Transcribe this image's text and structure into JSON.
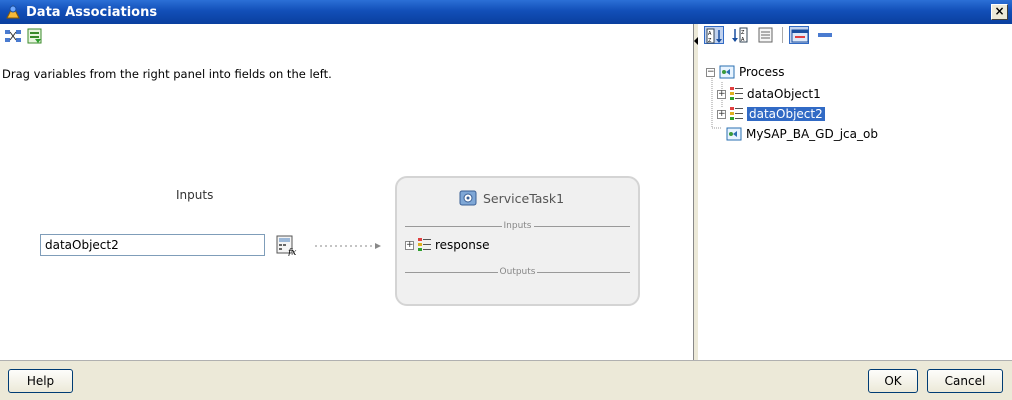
{
  "window": {
    "title": "Data Associations",
    "close_label": "×"
  },
  "left_panel": {
    "hint": "Drag variables from the right panel into fields on the left.",
    "inputs_label": "Inputs",
    "input_value": "dataObject2",
    "task": {
      "title": "ServiceTask1",
      "inputs_section": "Inputs",
      "outputs_section": "Outputs",
      "response_label": "response",
      "response_expander": "+"
    }
  },
  "right_panel": {
    "tree": {
      "root_label": "Process",
      "root_expander": "−",
      "items": [
        {
          "label": "dataObject1",
          "expander": "+",
          "selected": false
        },
        {
          "label": "dataObject2",
          "expander": "+",
          "selected": true
        }
      ],
      "sibling_label": "MySAP_BA_GD_jca_ob"
    }
  },
  "footer": {
    "help_label": "Help",
    "ok_label": "OK",
    "cancel_label": "Cancel"
  },
  "colors": {
    "titlebar": "#124fb8",
    "selection": "#316ac5",
    "dialog_bg": "#ece9d8"
  }
}
